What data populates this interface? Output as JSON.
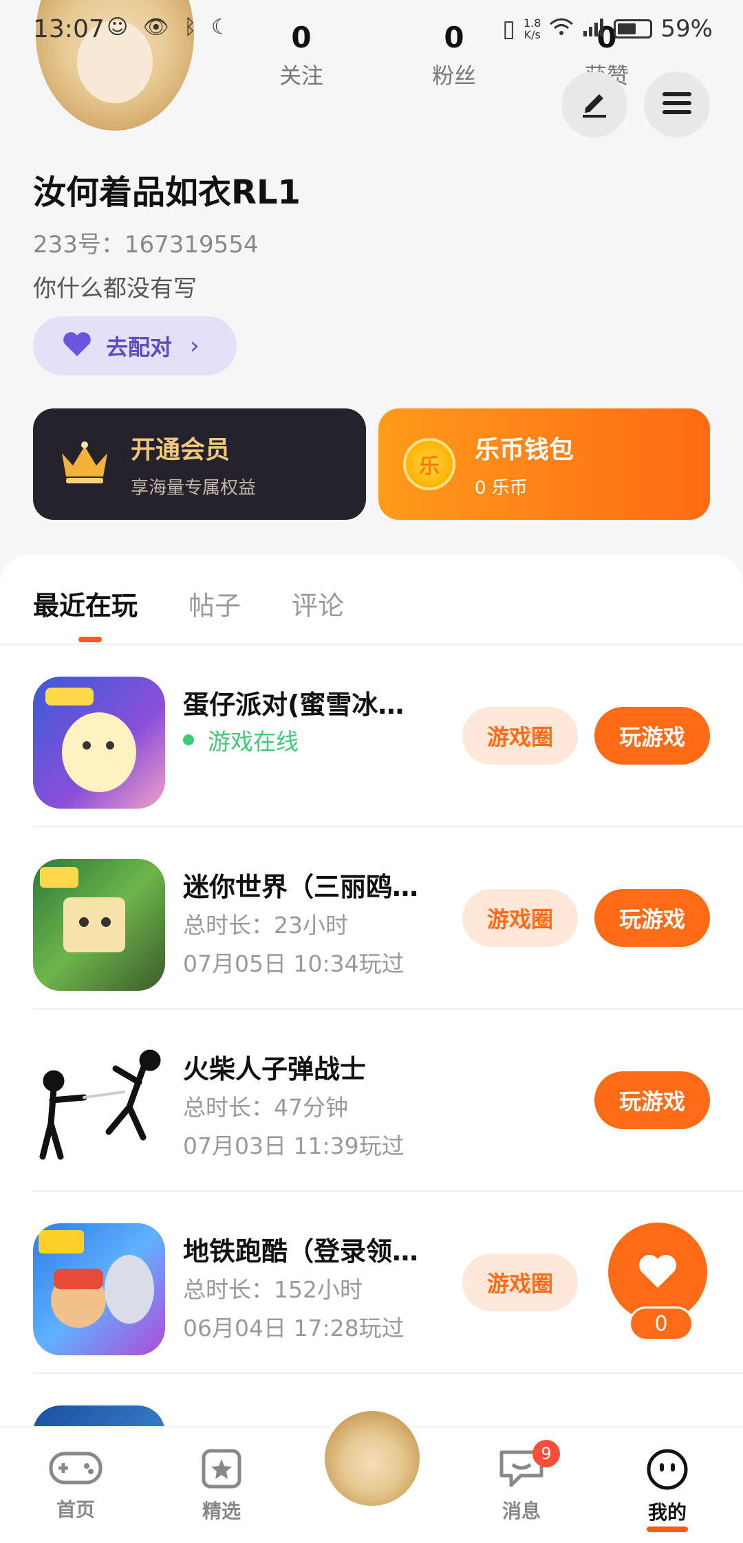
{
  "status_bar": {
    "time": "13:07",
    "icons": "☺ 👁 ᛒ ☾",
    "speed_top": "1.8",
    "speed_unit": "K/s",
    "battery": "59%",
    "battery_level": 0.59
  },
  "profile": {
    "stats": [
      {
        "num": "0",
        "label": "关注"
      },
      {
        "num": "0",
        "label": "粉丝"
      },
      {
        "num": "0",
        "label": "获赞"
      }
    ],
    "username": "汝何着品如衣RL1",
    "uid": "233号：167319554",
    "bio": "你什么都没有写",
    "pair_label": "去配对"
  },
  "cards": {
    "vip": {
      "title": "开通会员",
      "sub": "享海量专属权益"
    },
    "wallet": {
      "title": "乐币钱包",
      "sub": "0 乐币",
      "coin": "乐"
    }
  },
  "tabs": [
    "最近在玩",
    "帖子",
    "评论"
  ],
  "games": [
    {
      "name": "蛋仔派对(蜜雪冰…",
      "status": "游戏在线",
      "circle": "游戏圈",
      "play": "玩游戏"
    },
    {
      "name": "迷你世界（三丽鸥…",
      "duration": "总时长：23小时",
      "last": "07月05日 10:34玩过",
      "circle": "游戏圈",
      "play": "玩游戏"
    },
    {
      "name": "火柴人子弹战士",
      "duration": "总时长：47分钟",
      "last": "07月03日 11:39玩过",
      "play": "玩游戏"
    },
    {
      "name": "地铁跑酷（登录领…",
      "duration": "总时长：152小时",
      "last": "06月04日 17:28玩过",
      "circle": "游戏圈"
    }
  ],
  "float_like": {
    "count": "0"
  },
  "nav": [
    {
      "label": "首页",
      "icon": "gamepad-icon"
    },
    {
      "label": "精选",
      "icon": "star-icon"
    },
    {
      "label": "消息",
      "icon": "message-icon",
      "badge": "9"
    },
    {
      "label": "我的",
      "icon": "face-icon"
    }
  ],
  "colors": {
    "accent": "#ff6a14",
    "online": "#3ecb74",
    "pair": "#5b4cc4"
  }
}
